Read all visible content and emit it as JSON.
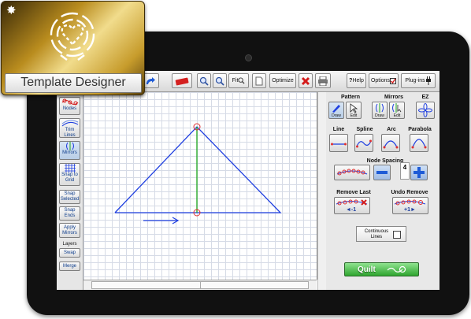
{
  "badge": {
    "title": "Template Designer",
    "icon": "heart-in-circle-logo"
  },
  "toolbar": {
    "fit_label": "Fit",
    "optimize_label": "Optimize",
    "help_label": "Help",
    "options_label": "Options",
    "plugins_label": "Plug-ins"
  },
  "left_tools": {
    "nodes": "Nodes",
    "trim_lines": "Trim Lines",
    "mirrors": "Mirrors",
    "snap_to_grid": "Snap to Grid",
    "snap_selected": "Snap Selected",
    "snap_ends": "Snap Ends",
    "apply_mirrors": "Apply Mirrors",
    "layers": "Layers",
    "swap": "Swap",
    "merge": "Merge"
  },
  "right_panel": {
    "pattern": "Pattern",
    "mirrors": "Mirrors",
    "ez": "EZ",
    "draw": "Draw",
    "edit": "Edit",
    "line": "Line",
    "spline": "Spline",
    "arc": "Arc",
    "parabola": "Parabola",
    "node_spacing": "Node Spacing",
    "node_spacing_value": "4",
    "remove_last": "Remove Last",
    "undo_remove": "Undo Remove",
    "continuous_lines": "Continuous Lines",
    "quilt": "Quilt"
  },
  "colors": {
    "pattern_line": "#1f3fe0",
    "mirror_line": "#1ea81e",
    "node": "#e03030",
    "quilt_green": "#2fa52f"
  }
}
